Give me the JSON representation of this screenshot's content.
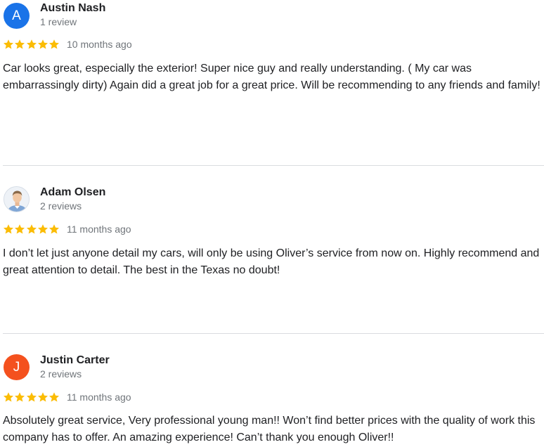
{
  "theme": {
    "star_color": "#fbbc04",
    "avatar_colors": {
      "austin": "#1a73e8",
      "justin": "#f4511e"
    }
  },
  "reviews": [
    {
      "avatar_letter": "A",
      "name": "Austin Nash",
      "review_count": "1 review",
      "rating": 5,
      "time": "10 months ago",
      "text": "Car looks great, especially the exterior! Super nice guy and really understanding. ( My car was embarrassingly dirty) Again did a great job for a great price. Will be recommending to any friends and family!"
    },
    {
      "avatar_icon": "profile-photo-icon",
      "name": "Adam Olsen",
      "review_count": "2 reviews",
      "rating": 5,
      "time": "11 months ago",
      "text": "I don’t let just anyone detail my cars, will only be using Oliver’s service from now on. Highly recommend and great attention to detail. The best in the Texas no doubt!"
    },
    {
      "avatar_letter": "J",
      "name": "Justin Carter",
      "review_count": "2 reviews",
      "rating": 5,
      "time": "11 months ago",
      "text": "Absolutely great service, Very professional young man!! Won’t find better prices with the quality of work this company has to offer. An amazing experience! Can’t thank you enough Oliver!!"
    }
  ]
}
